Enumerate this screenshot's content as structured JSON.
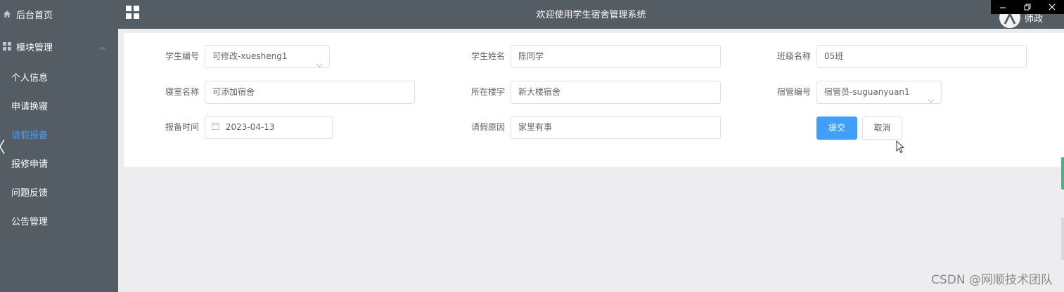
{
  "sidebar": {
    "home": "后台首页",
    "module": "模块管理",
    "items": [
      {
        "label": "个人信息"
      },
      {
        "label": "申请换寝"
      },
      {
        "label": "请假报备"
      },
      {
        "label": "报修申请"
      },
      {
        "label": "问题反馈"
      },
      {
        "label": "公告管理"
      }
    ]
  },
  "header": {
    "title": "欢迎使用学生宿舍管理系统",
    "username": "师政"
  },
  "form": {
    "student_no": {
      "label": "学生编号",
      "value": "可修改-xuesheng1"
    },
    "student_name": {
      "label": "学生姓名",
      "value": "陈同学"
    },
    "class_name": {
      "label": "班级名称",
      "value": "05班"
    },
    "room_name": {
      "label": "寝室名称",
      "value": "可添加宿舍"
    },
    "building": {
      "label": "所在楼宇",
      "value": "新大楼宿舍"
    },
    "manager_no": {
      "label": "宿管编号",
      "value": "宿管员-suguanyuan1"
    },
    "report_time": {
      "label": "报备时间",
      "value": "2023-04-13"
    },
    "leave_reason": {
      "label": "请假原因",
      "value": "家里有事"
    },
    "submit": "提交",
    "cancel": "取消"
  },
  "watermark": "CSDN @网顺技术团队",
  "colors": {
    "sidebar_bg": "#545c64",
    "active": "#409eff",
    "primary": "#409eff"
  }
}
